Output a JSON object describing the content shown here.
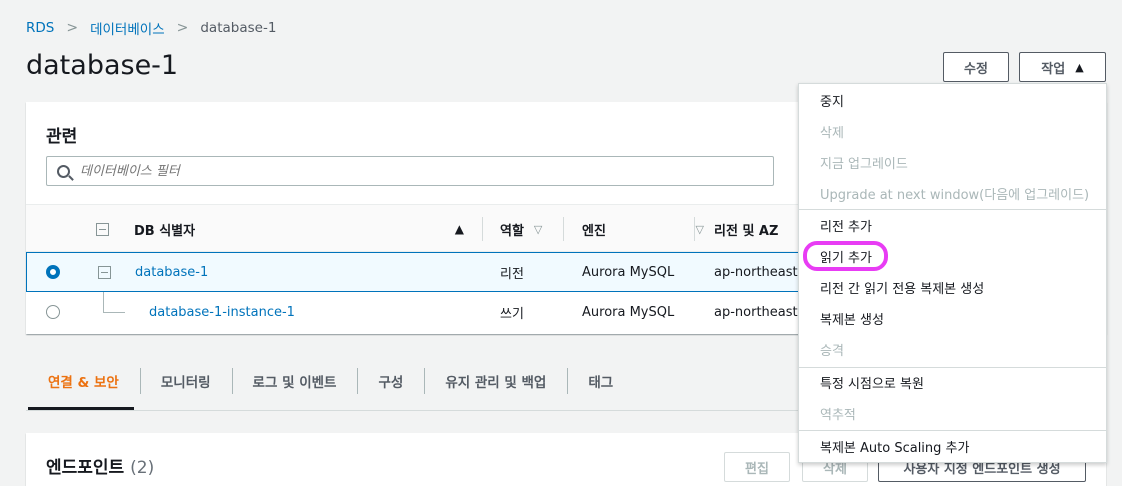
{
  "breadcrumb": {
    "items": [
      "RDS",
      "데이터베이스",
      "database-1"
    ],
    "separator": ">"
  },
  "page_title": "database-1",
  "header_buttons": {
    "modify": "수정",
    "actions": "작업",
    "actions_caret": "▲"
  },
  "related": {
    "title": "관련",
    "filter_placeholder": "데이터베이스 필터",
    "columns": {
      "identifier": "DB 식별자",
      "role": "역할",
      "engine": "엔진",
      "region_az": "리전 및 AZ"
    },
    "sort_asc": "▲",
    "sort_desc": "▽",
    "rows": [
      {
        "identifier": "database-1",
        "role": "리전",
        "engine": "Aurora MySQL",
        "region_az": "ap-northeast-",
        "selected": true
      },
      {
        "identifier": "database-1-instance-1",
        "role": "쓰기",
        "engine": "Aurora MySQL",
        "region_az": "ap-northeast-",
        "selected": false
      }
    ]
  },
  "tabs": [
    "연결 & 보안",
    "모니터링",
    "로그 및 이벤트",
    "구성",
    "유지 관리 및 백업",
    "태그"
  ],
  "active_tab": "연결 & 보안",
  "endpoints": {
    "title": "엔드포인트",
    "count": "(2)",
    "edit": "편집",
    "delete": "삭제",
    "create_custom": "사용자 지정 엔드포인트 생성"
  },
  "actions_menu": {
    "items": [
      {
        "label": "중지",
        "disabled": false
      },
      {
        "label": "삭제",
        "disabled": true
      },
      {
        "label": "지금 업그레이드",
        "disabled": true
      },
      {
        "label": "Upgrade at next window(다음에 업그레이드)",
        "disabled": true
      },
      {
        "label": "리전 추가",
        "disabled": false
      },
      {
        "label": "읽기 추가",
        "disabled": false,
        "highlighted": true
      },
      {
        "label": "리전 간 읽기 전용 복제본 생성",
        "disabled": false
      },
      {
        "label": "복제본 생성",
        "disabled": false
      },
      {
        "label": "승격",
        "disabled": true
      },
      {
        "label": "특정 시점으로 복원",
        "disabled": false
      },
      {
        "label": "역추적",
        "disabled": true
      },
      {
        "label": "복제본 Auto Scaling 추가",
        "disabled": false
      }
    ]
  },
  "colors": {
    "link": "#0073bb",
    "active_tab": "#ec7211",
    "highlight_ring": "#e83cf4"
  }
}
